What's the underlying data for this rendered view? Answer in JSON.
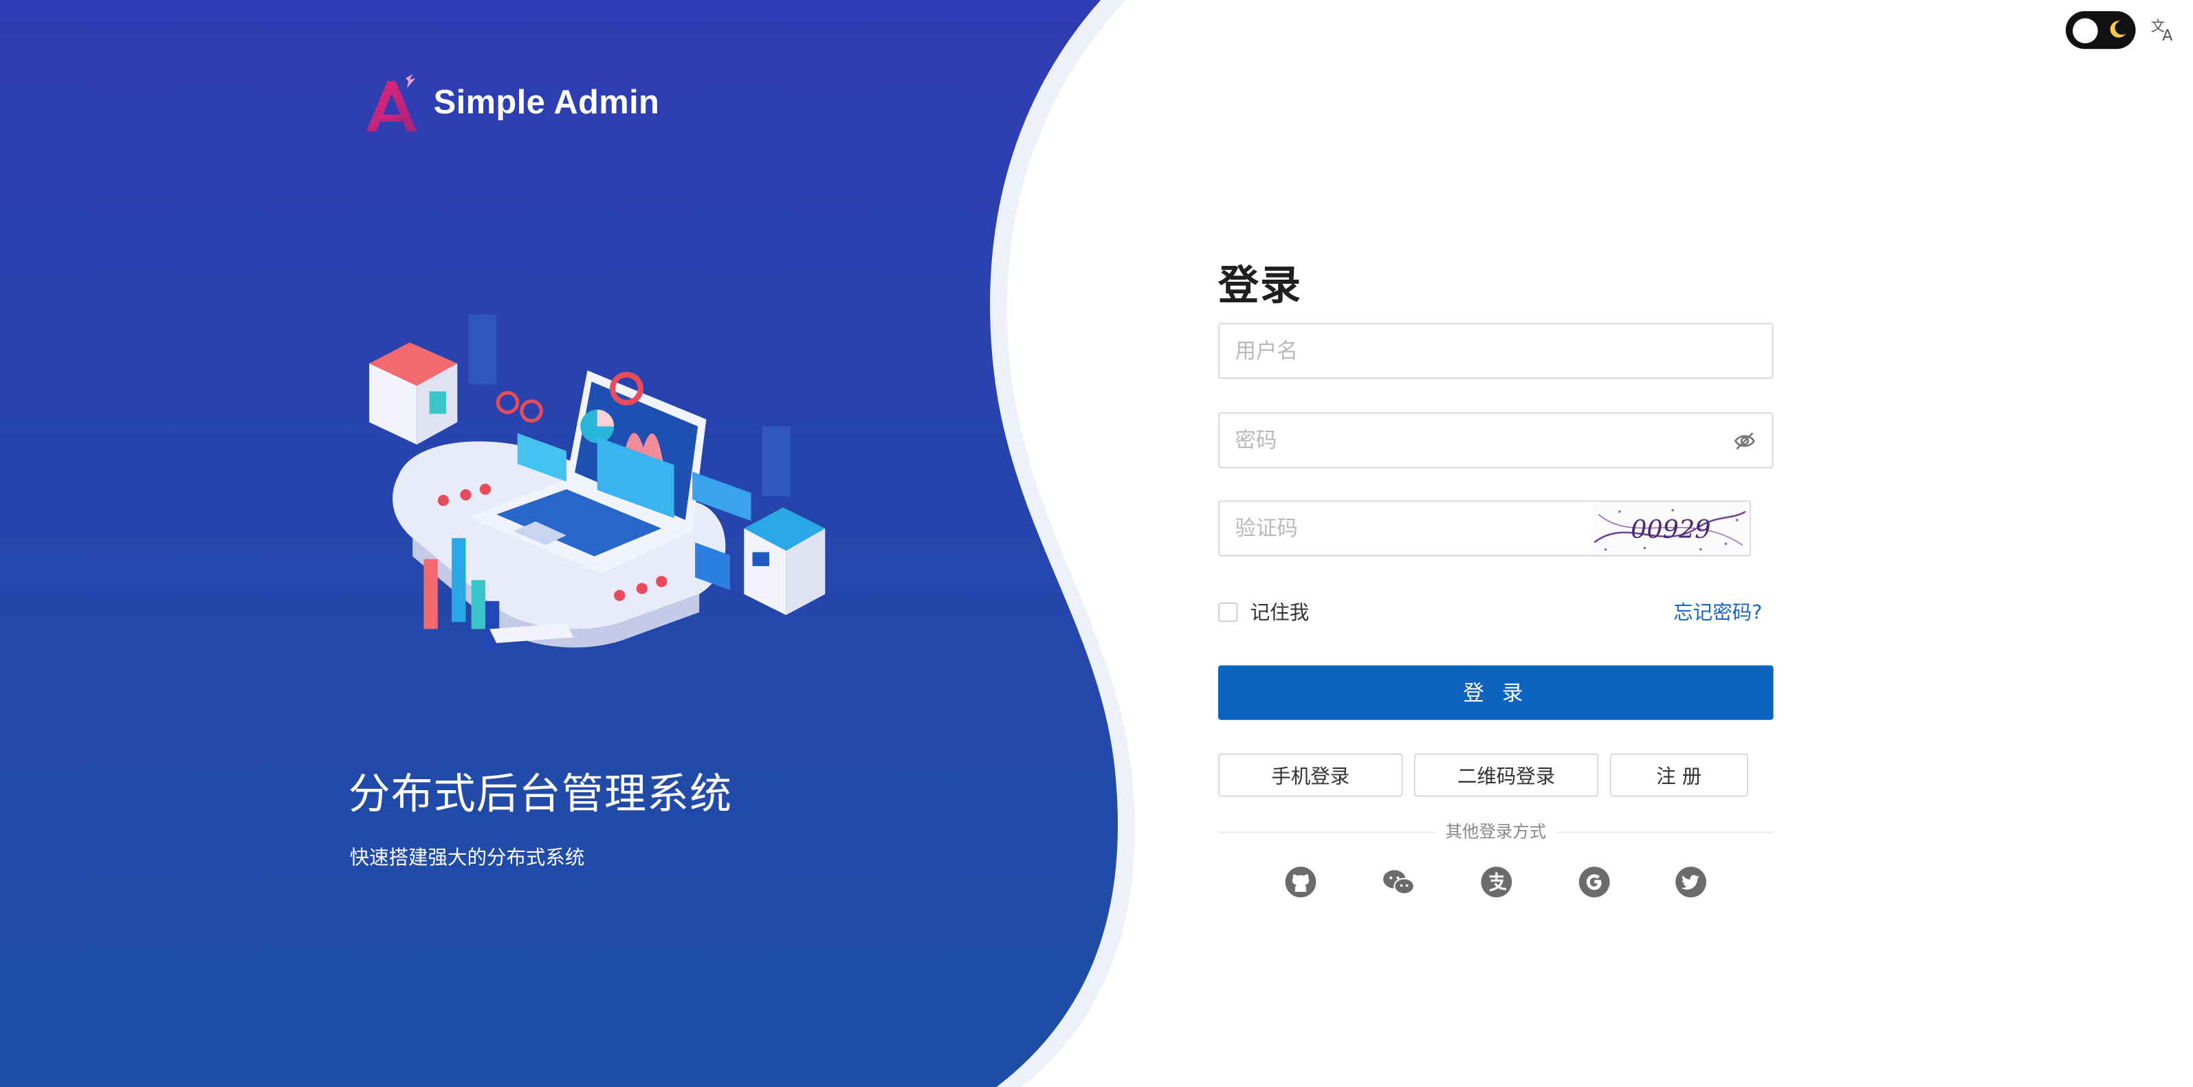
{
  "app": {
    "brand_name": "Simple Admin"
  },
  "hero": {
    "title": "分布式后台管理系统",
    "subtitle": "快速搭建强大的分布式系统"
  },
  "topbar": {
    "theme_toggle": "dark-mode-toggle",
    "language_icon": "translate-icon"
  },
  "login": {
    "title": "登录",
    "username_placeholder": "用户名",
    "password_placeholder": "密码",
    "captcha_placeholder": "验证码",
    "captcha_text": "00929",
    "remember_label": "记住我",
    "forgot_label": "忘记密码?",
    "submit_label": "登 录",
    "alt_buttons": [
      "手机登录",
      "二维码登录",
      "注 册"
    ],
    "other_methods_label": "其他登录方式",
    "social_icons": [
      "github-icon",
      "wechat-icon",
      "alipay-icon",
      "google-icon",
      "twitter-icon"
    ]
  },
  "colors": {
    "panel_top": "#2f3db4",
    "panel_bottom": "#1b4fa6",
    "primary": "#0c63c0",
    "link": "#1964c4"
  }
}
